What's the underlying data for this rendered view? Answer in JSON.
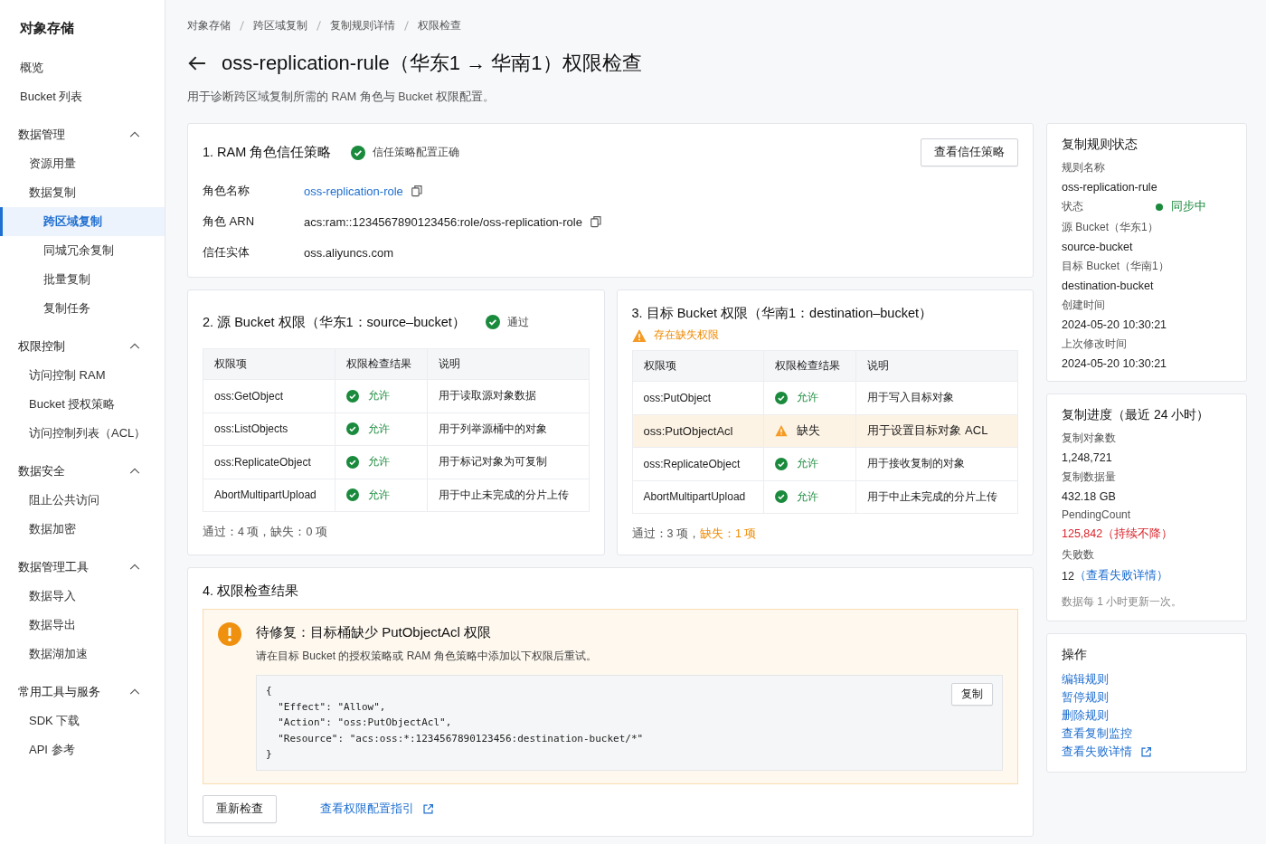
{
  "sidebar": {
    "title": "对象存储",
    "items": [
      {
        "label": "概览",
        "kind": "link",
        "selected": false
      },
      {
        "label": "Bucket 列表",
        "kind": "link",
        "selected": false
      },
      {
        "label": "数据管理",
        "kind": "group",
        "expanded": true,
        "children": [
          {
            "label": "资源用量",
            "selected": false
          },
          {
            "label": "数据复制",
            "selected": false,
            "children": [
              {
                "label": "跨区域复制",
                "selected": true
              },
              {
                "label": "同城冗余复制",
                "selected": false
              },
              {
                "label": "批量复制",
                "selected": false
              },
              {
                "label": "复制任务",
                "selected": false
              }
            ]
          }
        ]
      },
      {
        "label": "权限控制",
        "kind": "group",
        "expanded": true,
        "children": [
          {
            "label": "访问控制 RAM",
            "selected": false
          },
          {
            "label": "Bucket 授权策略",
            "selected": false
          },
          {
            "label": "访问控制列表（ACL）",
            "selected": false
          }
        ]
      },
      {
        "label": "数据安全",
        "kind": "group",
        "expanded": true,
        "children": [
          {
            "label": "阻止公共访问",
            "selected": false
          },
          {
            "label": "数据加密",
            "selected": false
          }
        ]
      },
      {
        "label": "数据管理工具",
        "kind": "group",
        "expanded": true,
        "children": [
          {
            "label": "数据导入",
            "selected": false
          },
          {
            "label": "数据导出",
            "selected": false
          },
          {
            "label": "数据湖加速",
            "selected": false
          }
        ]
      },
      {
        "label": "常用工具与服务",
        "kind": "group",
        "expanded": true,
        "children": [
          {
            "label": "SDK 下载",
            "selected": false
          },
          {
            "label": "API 参考",
            "selected": false
          }
        ]
      }
    ]
  },
  "breadcrumb": [
    "对象存储",
    "跨区域复制",
    "复制规则详情",
    "权限检查"
  ],
  "page": {
    "title": "oss-replication-rule（华东1 → 华南1）权限检查",
    "subtitle": "用于诊断跨区域复制所需的 RAM 角色与 Bucket 权限配置。"
  },
  "trust_section": {
    "title": "1. RAM 角色信任策略",
    "kind": "ok",
    "status_text": "信任策略配置正确",
    "button": "查看信任策略",
    "fields": [
      {
        "label": "角色名称",
        "value": "oss-replication-role",
        "link": true,
        "copyable": true
      },
      {
        "label": "角色 ARN",
        "value": "acs:ram::1234567890123456:role/oss-replication-role",
        "link": false,
        "copyable": true
      },
      {
        "label": "信任实体",
        "value": "oss.aliyuncs.com",
        "link": false,
        "copyable": false
      }
    ]
  },
  "bucket_sections": [
    {
      "title": "2. 源 Bucket 权限（华东1：source–bucket）",
      "kind": "ok",
      "status_text": "通过",
      "columns": [
        "权限项",
        "权限检查结果",
        "说明"
      ],
      "rows": [
        {
          "permission": "oss:GetObject",
          "kind": "allow",
          "result_text": "允许",
          "description": "用于读取源对象数据"
        },
        {
          "permission": "oss:ListObjects",
          "kind": "allow",
          "result_text": "允许",
          "description": "用于列举源桶中的对象"
        },
        {
          "permission": "oss:ReplicateObject",
          "kind": "allow",
          "result_text": "允许",
          "description": "用于标记对象为可复制"
        },
        {
          "permission": "AbortMultipartUpload",
          "kind": "allow",
          "result_text": "允许",
          "description": "用于中止未完成的分片上传"
        }
      ],
      "summary_passed": "通过：4 项，",
      "summary_missing": "缺失：0 项",
      "missing_warn": false
    },
    {
      "title": "3. 目标 Bucket 权限（华南1：destination–bucket）",
      "kind": "warn",
      "status_text": "存在缺失权限",
      "columns": [
        "权限项",
        "权限检查结果",
        "说明"
      ],
      "rows": [
        {
          "permission": "oss:PutObject",
          "kind": "allow",
          "result_text": "允许",
          "description": "用于写入目标对象"
        },
        {
          "permission": "oss:PutObjectAcl",
          "kind": "missing",
          "result_text": "缺失",
          "description": "用于设置目标对象 ACL"
        },
        {
          "permission": "oss:ReplicateObject",
          "kind": "allow",
          "result_text": "允许",
          "description": "用于接收复制的对象"
        },
        {
          "permission": "AbortMultipartUpload",
          "kind": "allow",
          "result_text": "允许",
          "description": "用于中止未完成的分片上传"
        }
      ],
      "summary_passed": "通过：3 项，",
      "summary_missing": "缺失：1 项",
      "missing_warn": true
    }
  ],
  "result_section": {
    "title": "4. 权限检查结果",
    "alert": {
      "title": "待修复：目标桶缺少 PutObjectAcl 权限",
      "message": "请在目标 Bucket 的授权策略或 RAM 角色策略中添加以下权限后重试。",
      "code": "{\n  \"Effect\": \"Allow\",\n  \"Action\": \"oss:PutObjectAcl\",\n  \"Resource\": \"acs:oss:*:1234567890123456:destination-bucket/*\"\n}",
      "copy_button": "复制"
    },
    "recheck_button": "重新检查",
    "guide_link": "查看权限配置指引"
  },
  "status_card": {
    "title": "复制规则状态",
    "fields": [
      {
        "label": "规则名称",
        "value": "oss-replication-rule",
        "kind": "text"
      },
      {
        "label": "状态",
        "value": "同步中",
        "kind": "status",
        "color": "#1a8a3c"
      },
      {
        "label": "源 Bucket（华东1）",
        "value": "source-bucket",
        "kind": "text"
      },
      {
        "label": "目标 Bucket（华南1）",
        "value": "destination-bucket",
        "kind": "text"
      },
      {
        "label": "创建时间",
        "value": "2024-05-20 10:30:21",
        "kind": "text"
      },
      {
        "label": "上次修改时间",
        "value": "2024-05-20 10:30:21",
        "kind": "text"
      }
    ]
  },
  "progress_card": {
    "title": "复制进度（最近 24 小时）",
    "fields": [
      {
        "label": "复制对象数",
        "value": "1,248,721",
        "kind": "text"
      },
      {
        "label": "复制数据量",
        "value": "432.18 GB",
        "kind": "text"
      },
      {
        "label": "PendingCount",
        "value": "125,842（持续不降）",
        "kind": "danger"
      },
      {
        "label": "失败数",
        "value": "12",
        "link": "（查看失败详情）",
        "kind": "link"
      }
    ],
    "note": "数据每 1 小时更新一次。"
  },
  "actions_card": {
    "title": "操作",
    "links": [
      {
        "label": "编辑规则",
        "external": false
      },
      {
        "label": "暂停规则",
        "external": false
      },
      {
        "label": "删除规则",
        "external": false
      },
      {
        "label": "查看复制监控",
        "external": false
      },
      {
        "label": "查看失败详情",
        "external": true
      }
    ]
  }
}
